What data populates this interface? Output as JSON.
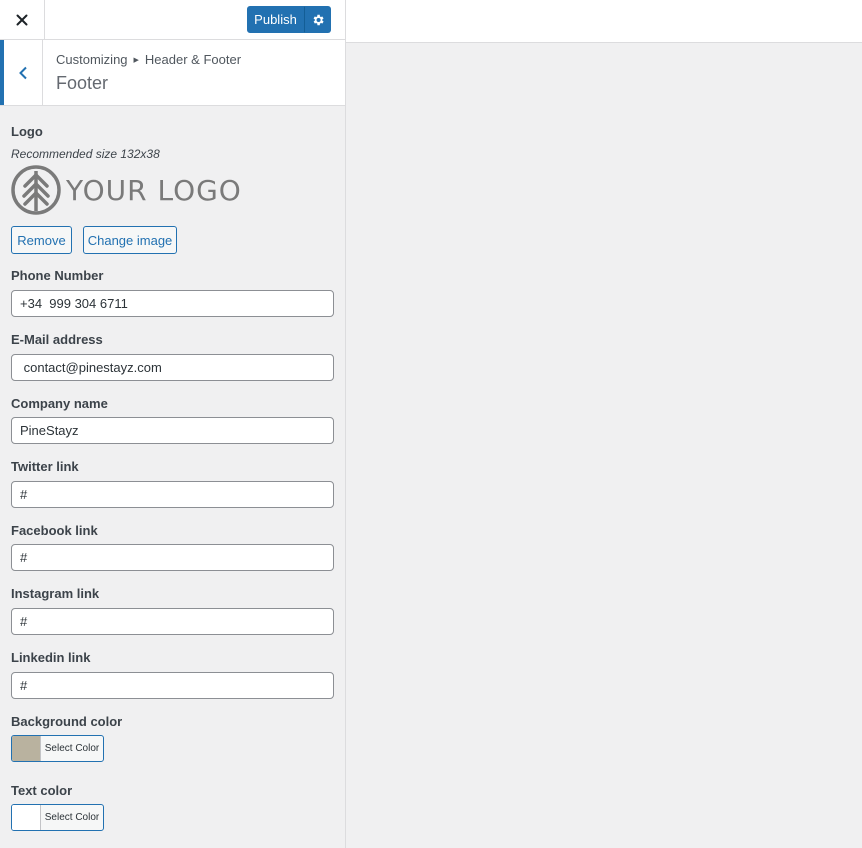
{
  "topbar": {
    "publish_label": "Publish"
  },
  "header": {
    "breadcrumb": [
      "Customizing",
      "Header & Footer"
    ],
    "title": "Footer"
  },
  "logo": {
    "label": "Logo",
    "description": "Recommended size 132x38",
    "image_text": "YOUR LOGO",
    "remove_label": "Remove",
    "change_label": "Change image"
  },
  "fields": {
    "phone": {
      "label": "Phone Number",
      "value": "+34  999 304 6711"
    },
    "email": {
      "label": "E-Mail address",
      "value": " contact@pinestayz.com"
    },
    "company": {
      "label": "Company name",
      "value": "PineStayz"
    },
    "twitter": {
      "label": "Twitter link",
      "value": "#"
    },
    "facebook": {
      "label": "Facebook link",
      "value": "#"
    },
    "instagram": {
      "label": "Instagram link",
      "value": "#"
    },
    "linkedin": {
      "label": "Linkedin link",
      "value": "#"
    }
  },
  "colors": {
    "background": {
      "label": "Background color",
      "button": "Select Color",
      "value": "#b9b29f"
    },
    "text": {
      "label": "Text color",
      "button": "Select Color",
      "value": "#ffffff"
    }
  }
}
